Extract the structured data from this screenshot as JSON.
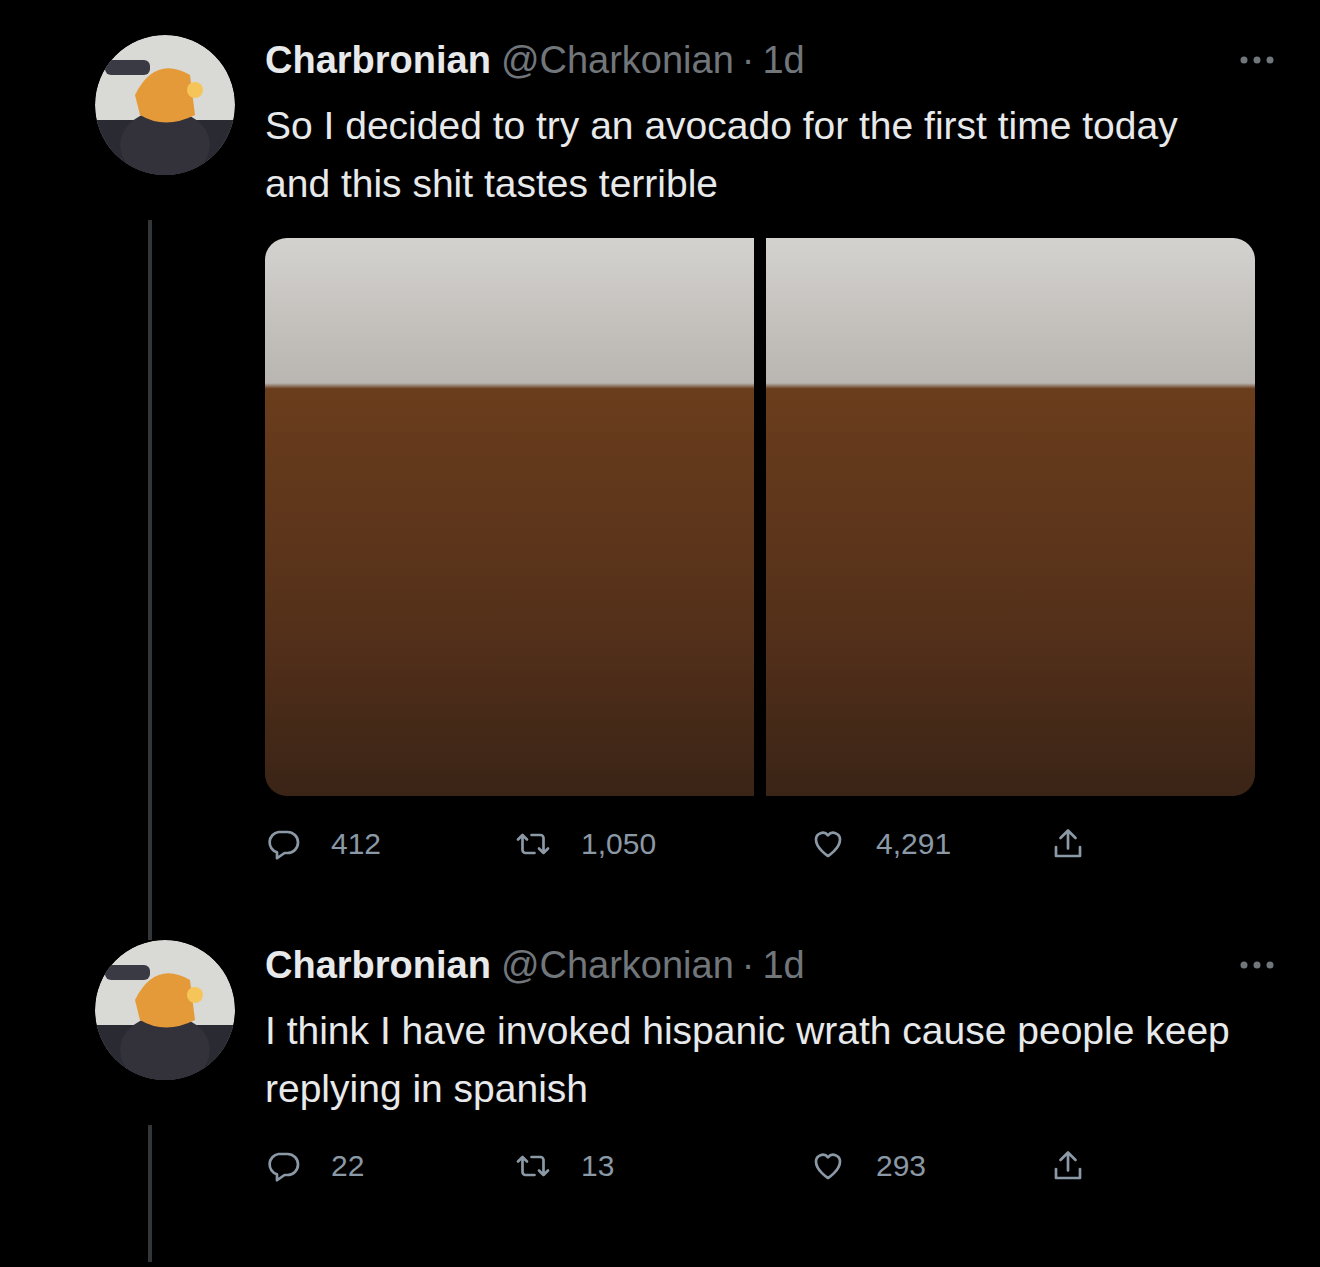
{
  "tweets": [
    {
      "display_name": "Charbronian",
      "handle": "@Charkonian",
      "separator": "·",
      "time": "1d",
      "text": "So I decided to try an avocado for the first time today and this shit tastes terrible",
      "media": [
        {
          "kind": "photo"
        },
        {
          "kind": "photo"
        }
      ],
      "replies": "412",
      "retweets": "1,050",
      "likes": "4,291"
    },
    {
      "display_name": "Charbronian",
      "handle": "@Charkonian",
      "separator": "·",
      "time": "1d",
      "text": "I think I have invoked hispanic wrath cause people keep replying in spanish",
      "media": [],
      "replies": "22",
      "retweets": "13",
      "likes": "293"
    }
  ]
}
